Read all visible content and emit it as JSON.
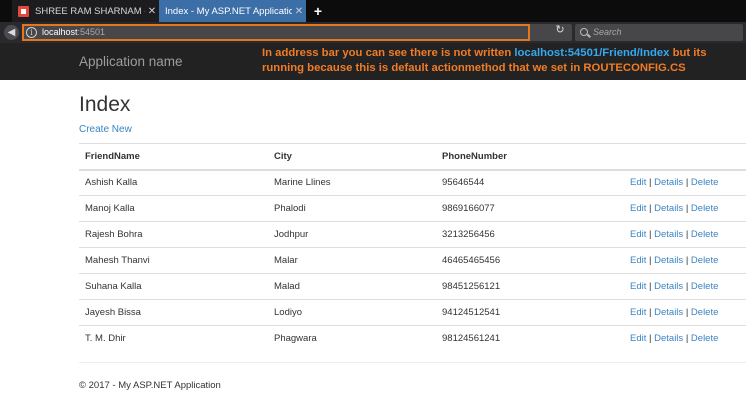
{
  "browser": {
    "tabs": [
      {
        "title": "SHREE RAM SHARNAM - Inte",
        "active": false
      },
      {
        "title": "Index - My ASP.NET Application",
        "active": true
      }
    ],
    "new_tab_label": "+",
    "url_host": "localhost",
    "url_port": ":54501",
    "search_placeholder": "Search",
    "icons": {
      "back": "back-arrow-icon",
      "info": "info-icon",
      "reload": "reload-icon",
      "search": "search-icon",
      "close": "close-icon"
    }
  },
  "navbar": {
    "brand": "Application name",
    "annotation_line1_prefix": "In address bar you can see there is not written ",
    "annotation_url": "localhost:54501/Friend/Index",
    "annotation_line1_suffix": " but its",
    "annotation_line2": "running because this is default actionmethod that we set in ROUTECONFIG.CS"
  },
  "page": {
    "title": "Index",
    "create_link": "Create New",
    "table": {
      "headers": [
        "FriendName",
        "City",
        "PhoneNumber"
      ],
      "rows": [
        {
          "name": "Ashish Kalla",
          "city": "Marine Llines",
          "phone": "95646544"
        },
        {
          "name": "Manoj Kalla",
          "city": "Phalodi",
          "phone": "9869166077"
        },
        {
          "name": "Rajesh Bohra",
          "city": "Jodhpur",
          "phone": "3213256456"
        },
        {
          "name": "Mahesh Thanvi",
          "city": "Malar",
          "phone": "46465465456"
        },
        {
          "name": "Suhana Kalla",
          "city": "Malad",
          "phone": "98451256121"
        },
        {
          "name": "Jayesh Bissa",
          "city": "Lodiyo",
          "phone": "94124512541"
        },
        {
          "name": "T. M. Dhir",
          "city": "Phagwara",
          "phone": "98124561241"
        }
      ],
      "actions": {
        "edit": "Edit",
        "details": "Details",
        "delete": "Delete",
        "separator": "|"
      }
    },
    "footer": "© 2017 - My ASP.NET Application"
  },
  "colors": {
    "annotation": "#f07c27",
    "annotation_url": "#36a8f0",
    "highlight_box": "#e6761c",
    "link": "#3a84c4",
    "navbar": "#222222"
  }
}
